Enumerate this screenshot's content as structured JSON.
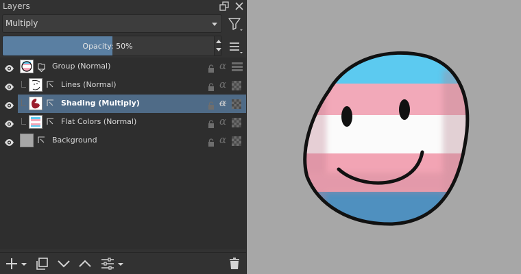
{
  "docker": {
    "title": "Layers",
    "blend_mode": "Multiply",
    "opacity_label": "Opacity:",
    "opacity_value": "50%",
    "opacity_fraction": 0.5
  },
  "layers": [
    {
      "name": "Group (Normal)",
      "selected": false,
      "indent": 0,
      "thumb": "group",
      "type_icon": "folder-icon"
    },
    {
      "name": "Lines (Normal)",
      "selected": false,
      "indent": 1,
      "thumb": "lines",
      "type_icon": "paint-layer-icon"
    },
    {
      "name": "Shading (Multiply)",
      "selected": true,
      "indent": 1,
      "thumb": "shading",
      "type_icon": "paint-layer-icon"
    },
    {
      "name": "Flat Colors (Normal)",
      "selected": false,
      "indent": 1,
      "thumb": "flat",
      "type_icon": "paint-layer-icon"
    },
    {
      "name": "Background",
      "selected": false,
      "indent": 0,
      "thumb": "bg",
      "type_icon": "paint-layer-icon"
    }
  ],
  "colors": {
    "accent": "#4f6b87",
    "opacity_fill": "#5a7fa2",
    "flag_blue": "#5ccaf0",
    "flag_pink": "#f4a7b8",
    "flag_white": "#ffffff",
    "canvas_bg": "#a7a7a7"
  }
}
